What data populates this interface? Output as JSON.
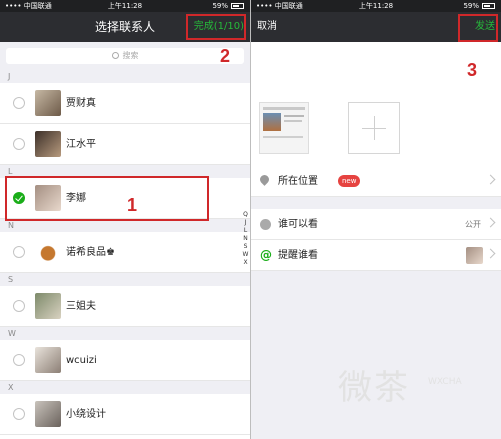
{
  "left": {
    "status": {
      "carrier": "•••• 中国联通",
      "time": "上午11:28",
      "battery": "59%"
    },
    "nav": {
      "title": "选择联系人",
      "done": "完成(1/10)"
    },
    "search": {
      "placeholder": "搜索"
    },
    "sections": [
      "J",
      "L",
      "N",
      "S",
      "W",
      "X"
    ],
    "contacts": [
      "贾财真",
      "江水平",
      "李娜",
      "诺希良品♚",
      "三姐夫",
      "wcuizi",
      "小绕设计"
    ],
    "index": [
      "Q",
      "J",
      "L",
      "N",
      "S",
      "W",
      "X"
    ]
  },
  "right": {
    "status": {
      "carrier": "•••• 中国联通",
      "time": "上午11:28",
      "battery": "59%"
    },
    "nav": {
      "cancel": "取消",
      "send": "发送"
    },
    "location": {
      "label": "所在位置",
      "badge": "new"
    },
    "visibility": {
      "label": "谁可以看",
      "value": "公开"
    },
    "mention": {
      "label": "提醒谁看"
    }
  },
  "annotations": [
    "1",
    "2",
    "3"
  ],
  "watermark": {
    "text": "微茶",
    "sub": "WXCHA"
  },
  "colors": {
    "accent": "#1aad19",
    "annotation": "#d0282a",
    "nav_bg": "#2c2d31"
  }
}
